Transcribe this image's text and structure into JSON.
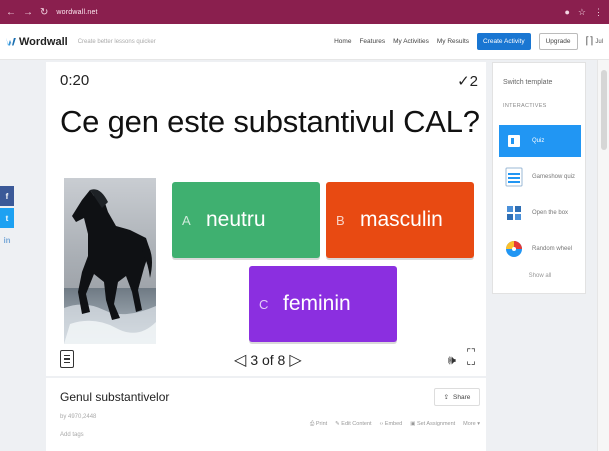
{
  "browser": {
    "nav_icons": [
      "back-icon",
      "forward-icon",
      "reload-icon"
    ],
    "url": "wordwall.net",
    "right_icons": [
      "extension-icon",
      "bookmark-icon",
      "menu-icon"
    ]
  },
  "header": {
    "logo": "Wordwall",
    "tagline": "Create better lessons quicker",
    "nav": [
      "Home",
      "Features",
      "My Activities",
      "My Results"
    ],
    "create_label": "Create Activity",
    "upgrade_label": "Upgrade",
    "account_label": "Jul"
  },
  "social": {
    "facebook": "f",
    "twitter": "t",
    "linkedin": "in"
  },
  "game": {
    "timer": "0:20",
    "score": "✓2",
    "question": "Ce gen este substantivul CAL?",
    "answers": [
      {
        "letter": "A",
        "text": "neutru",
        "color": "#3fb070"
      },
      {
        "letter": "B",
        "text": "masculin",
        "color": "#e84a12"
      },
      {
        "letter": "C",
        "text": "feminin",
        "color": "#8b2fe0"
      }
    ],
    "pager": {
      "prev": "◁",
      "label": "3 of 8",
      "next": "▷"
    },
    "image": "horse-photo"
  },
  "info": {
    "title": "Genul substantivelor",
    "id": "by 4970,2448",
    "add_tags": "Add tags",
    "share_label": "Share",
    "actions": [
      "Print",
      "Edit Content",
      "Embed",
      "Set Assignment",
      "More"
    ]
  },
  "switch_template": {
    "title": "Switch template",
    "subtitle": "INTERACTIVES",
    "items": [
      {
        "name": "Quiz",
        "active": true
      },
      {
        "name": "Gameshow quiz",
        "active": false
      },
      {
        "name": "Open the box",
        "active": false
      },
      {
        "name": "Random wheel",
        "active": false
      }
    ],
    "show_all": "Show all"
  }
}
